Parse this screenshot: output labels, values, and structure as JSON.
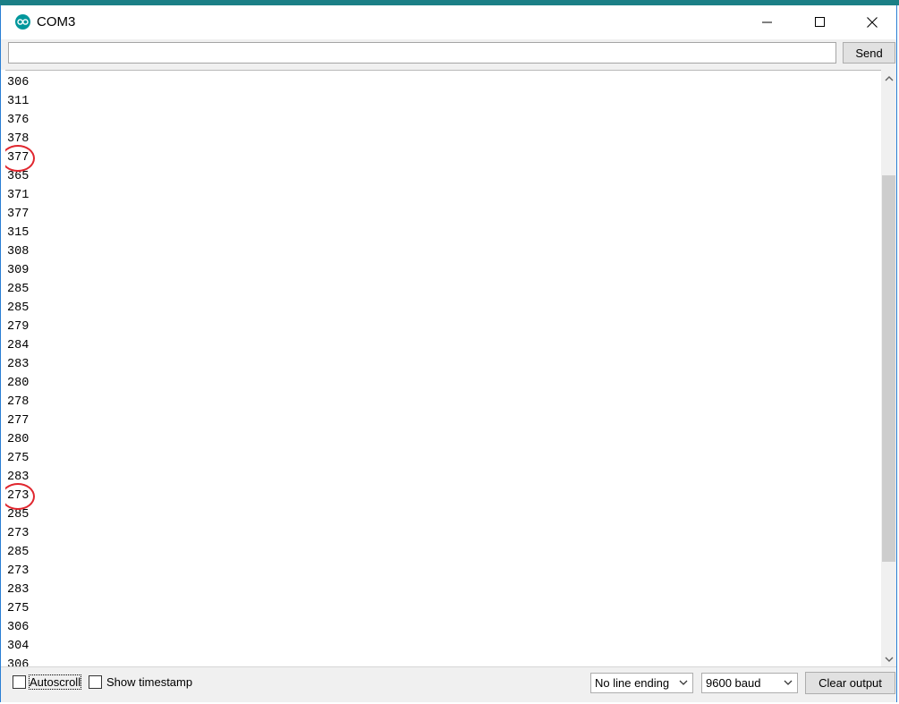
{
  "window": {
    "title": "COM3",
    "accent": "#00979c"
  },
  "send_row": {
    "input_value": "",
    "input_placeholder": "",
    "send_label": "Send"
  },
  "output": {
    "lines": [
      "306",
      "311",
      "376",
      "378",
      "377",
      "365",
      "371",
      "377",
      "315",
      "308",
      "309",
      "285",
      "285",
      "279",
      "284",
      "283",
      "280",
      "278",
      "277",
      "280",
      "275",
      "283",
      "273",
      "285",
      "273",
      "285",
      "273",
      "283",
      "275",
      "306",
      "304",
      "306"
    ],
    "circled_values": [
      "377",
      "273"
    ],
    "circle_color": "#e0262e"
  },
  "bottom": {
    "autoscroll_label": "Autoscroll",
    "autoscroll_checked": false,
    "timestamp_label": "Show timestamp",
    "timestamp_checked": false,
    "line_ending": "No line ending",
    "baud": "9600 baud",
    "clear_label": "Clear output"
  }
}
